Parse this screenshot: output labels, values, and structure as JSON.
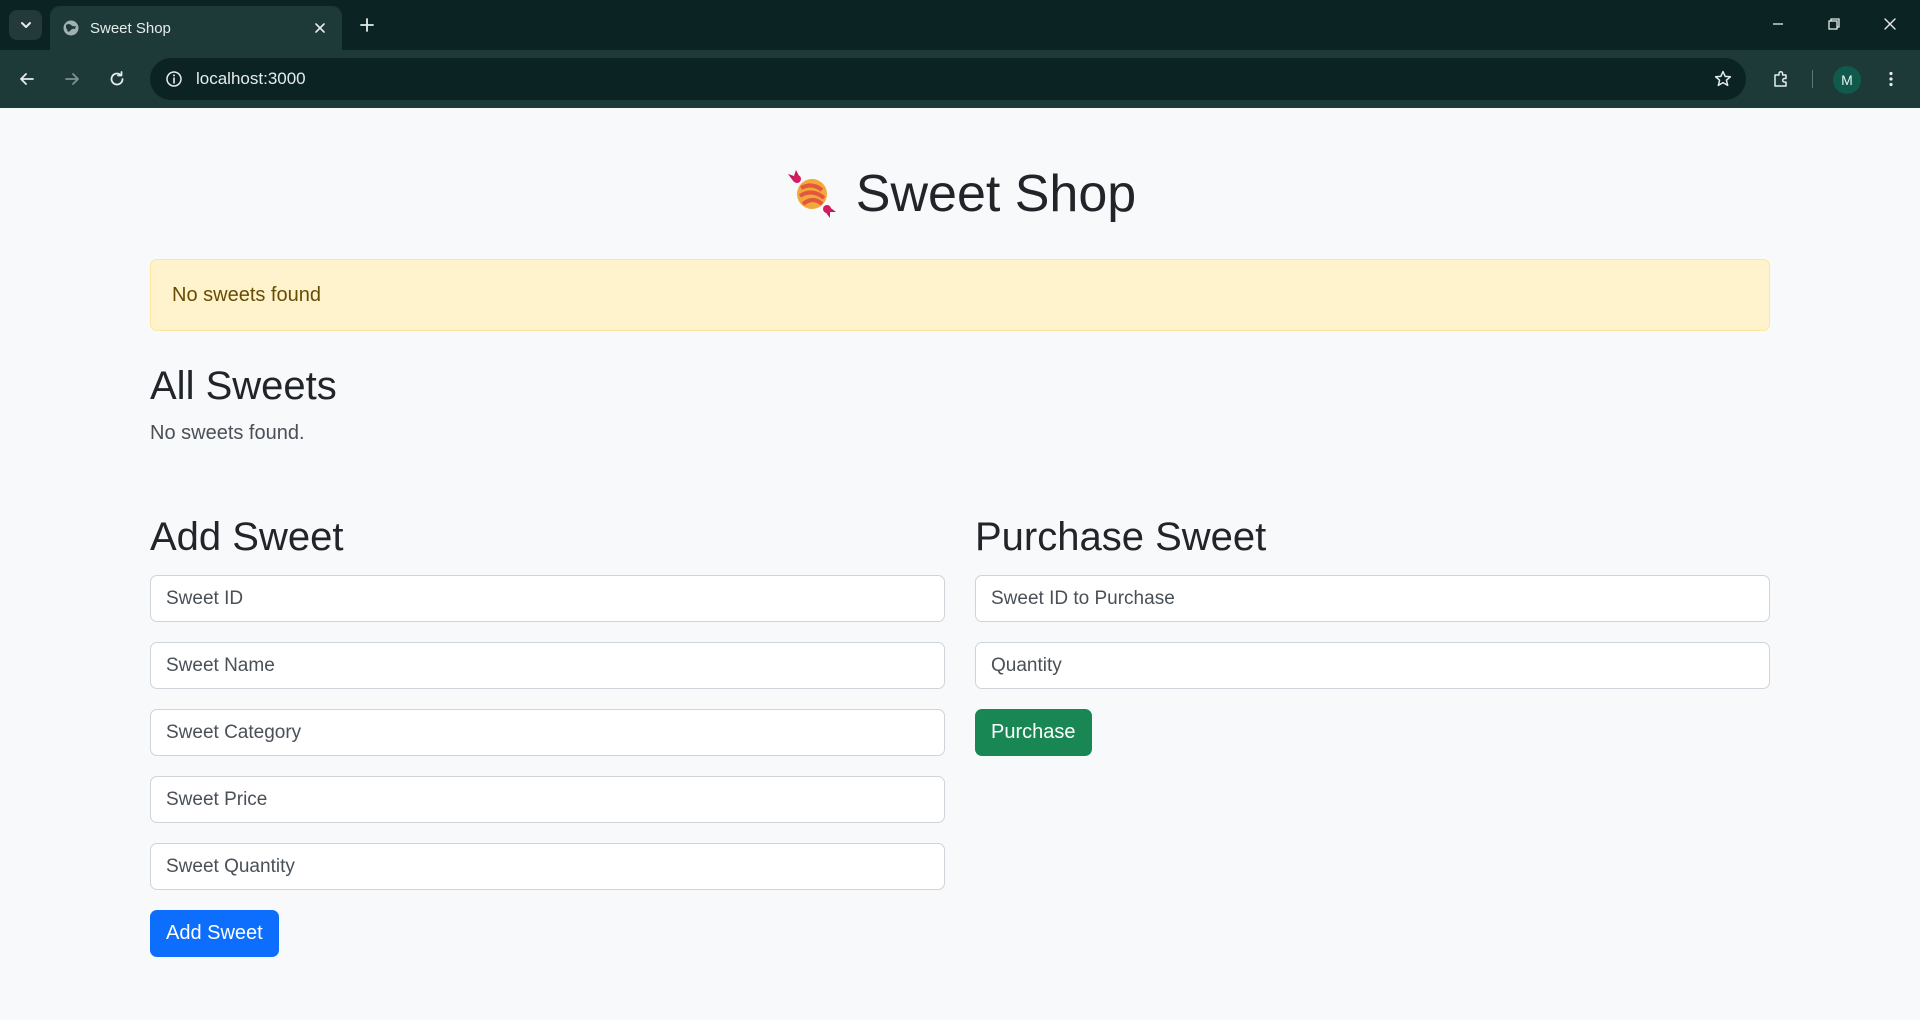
{
  "browser": {
    "tab_title": "Sweet Shop",
    "url": "localhost:3000",
    "profile_initial": "M"
  },
  "page": {
    "title": "Sweet Shop",
    "alert_text": "No sweets found",
    "all_sweets": {
      "heading": "All Sweets",
      "empty_text": "No sweets found."
    },
    "add_sweet": {
      "heading": "Add Sweet",
      "fields": {
        "id_placeholder": "Sweet ID",
        "name_placeholder": "Sweet Name",
        "category_placeholder": "Sweet Category",
        "price_placeholder": "Sweet Price",
        "quantity_placeholder": "Sweet Quantity"
      },
      "button_label": "Add Sweet"
    },
    "purchase_sweet": {
      "heading": "Purchase Sweet",
      "fields": {
        "id_placeholder": "Sweet ID to Purchase",
        "quantity_placeholder": "Quantity"
      },
      "button_label": "Purchase"
    }
  },
  "colors": {
    "primary": "#0d6efd",
    "success": "#198754",
    "alert_bg": "#fff3cd",
    "alert_text": "#664d03",
    "chrome_dark": "#0c2323",
    "chrome_mid": "#1d3a38"
  }
}
